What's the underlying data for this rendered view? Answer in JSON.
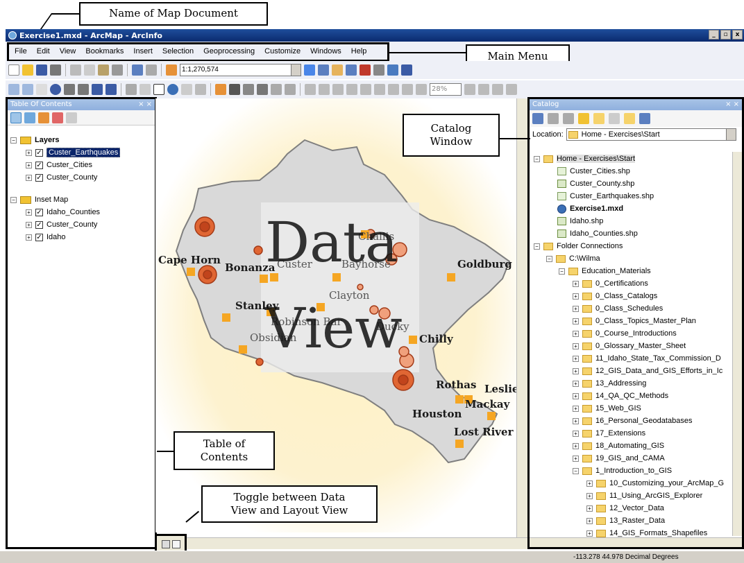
{
  "annotations": {
    "map_document": "Name of Map Document",
    "main_menu": "Main Menu",
    "catalog_window": [
      "Catalog",
      "Window"
    ],
    "toc": [
      "Table of",
      "Contents"
    ],
    "toggle": [
      "Toggle between Data",
      "View and Layout View"
    ]
  },
  "window": {
    "title": "Exercise1.mxd - ArcMap - ArcInfo",
    "min": "_",
    "max": "▫",
    "close": "x"
  },
  "menu": [
    "File",
    "Edit",
    "View",
    "Bookmarks",
    "Insert",
    "Selection",
    "Geoprocessing",
    "Customize",
    "Windows",
    "Help"
  ],
  "toolbar": {
    "scale": "1:1,270,574",
    "zoom": "28%"
  },
  "toc": {
    "title": "Table Of Contents",
    "groups": [
      {
        "name": "Layers",
        "layers": [
          "Custer_Earthquakes",
          "Custer_Cities",
          "Custer_County"
        ]
      },
      {
        "name": "Inset Map",
        "layers": [
          "Idaho_Counties",
          "Custer_County",
          "Idaho"
        ]
      }
    ]
  },
  "map": {
    "overlay_line1": "Data",
    "overlay_line2": "View",
    "cities": [
      "Cape Horn",
      "Bonanza",
      "Custer",
      "Challis",
      "Bayhorse",
      "Goldburg",
      "Clayton",
      "Stanley",
      "Robinson Bar",
      "Obsidian",
      "Ducky",
      "Chilly",
      "Rothas",
      "Leslie",
      "Mackay",
      "Houston",
      "Lost River"
    ]
  },
  "catalog": {
    "title": "Catalog",
    "location_label": "Location:",
    "location_value": "Home - Exercises\\Start",
    "home": "Home - Exercises\\Start",
    "home_items": [
      {
        "name": "Custer_Cities.shp",
        "type": "point"
      },
      {
        "name": "Custer_County.shp",
        "type": "poly"
      },
      {
        "name": "Custer_Earthquakes.shp",
        "type": "point"
      },
      {
        "name": "Exercise1.mxd",
        "type": "mxd"
      },
      {
        "name": "Idaho.shp",
        "type": "poly"
      },
      {
        "name": "Idaho_Counties.shp",
        "type": "poly"
      }
    ],
    "folder_connections": "Folder Connections",
    "drive": "C:\\Wilma",
    "education": "Education_Materials",
    "folders": [
      "0_Certifications",
      "0_Class_Catalogs",
      "0_Class_Schedules",
      "0_Class_Topics_Master_Plan",
      "0_Course_Introductions",
      "0_Glossary_Master_Sheet",
      "11_Idaho_State_Tax_Commission_D",
      "12_GIS_Data_and_GIS_Efforts_in_Ic",
      "13_Addressing",
      "14_QA_QC_Methods",
      "15_Web_GIS",
      "16_Personal_Geodatabases",
      "17_Extensions",
      "18_Automating_GIS",
      "19_GIS_and_CAMA",
      "1_Introduction_to_GIS"
    ],
    "subfolders": [
      "10_Customizing_your_ArcMap_G",
      "11_Using_ArcGIS_Explorer",
      "12_Vector_Data",
      "13_Raster_Data",
      "14_GIS_Formats_Shapefiles"
    ]
  },
  "status": {
    "coords": "-113.278  44.978 Decimal Degrees"
  }
}
